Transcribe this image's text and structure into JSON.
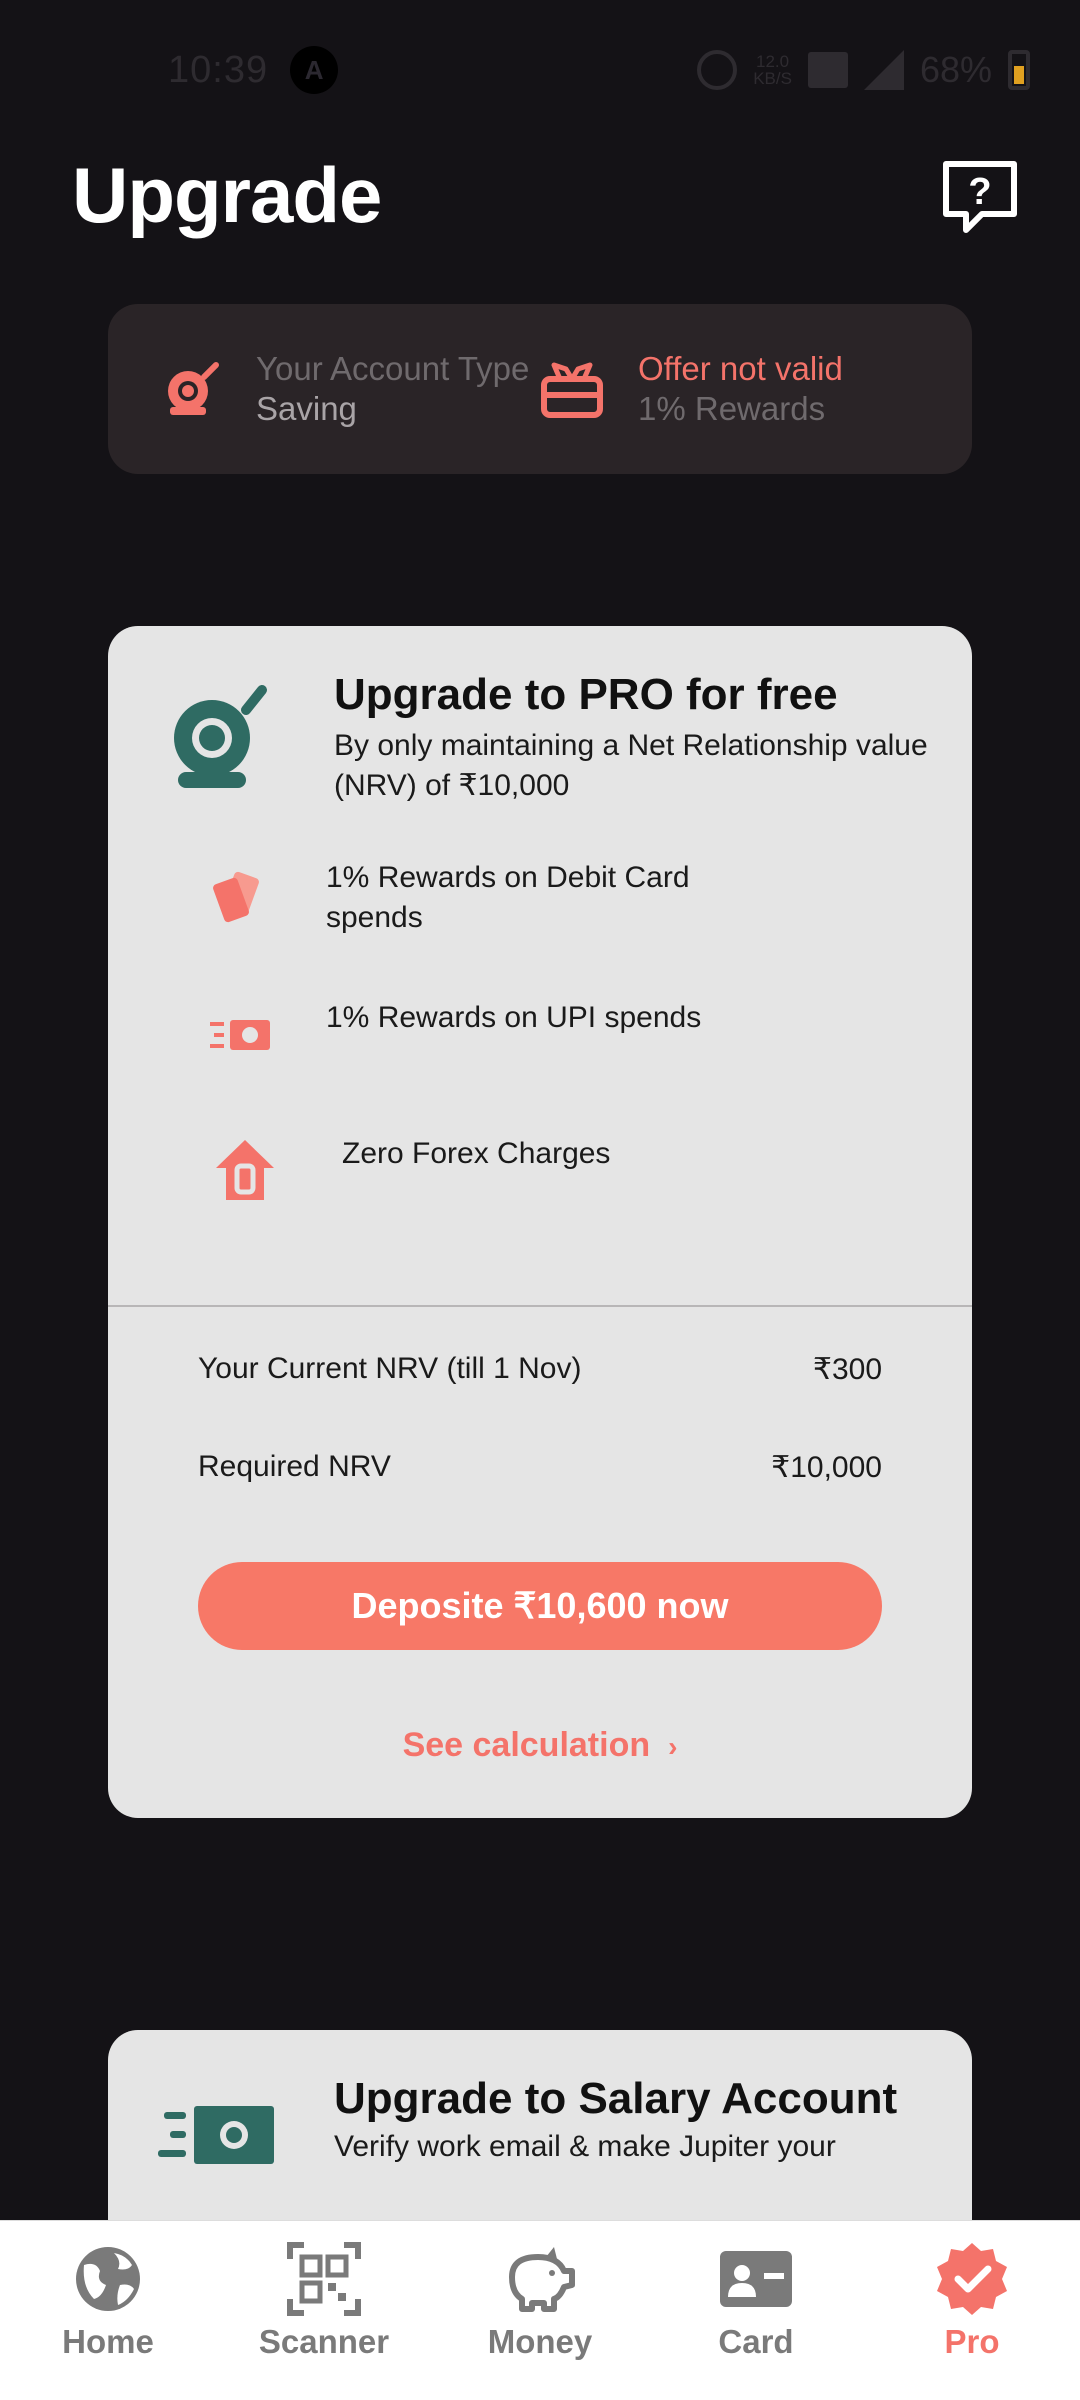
{
  "status_bar": {
    "time": "10:39",
    "app_badge": "A",
    "speed_value": "12.0",
    "speed_unit": "KB/S",
    "battery": "68%"
  },
  "header": {
    "title": "Upgrade",
    "help_icon": "question-chat-icon"
  },
  "account_strip": {
    "account_label": "Your Account Type",
    "account_value": "Saving",
    "offer_label": "Offer not valid",
    "offer_value": "1% Rewards"
  },
  "pro_card": {
    "title": "Upgrade to PRO for free",
    "subtitle": "By only maintaining a Net Relationship value (NRV) of ₹10,000",
    "benefits": [
      {
        "icon": "cards-icon",
        "text": "1% Rewards on Debit Card spends"
      },
      {
        "icon": "cash-fast-icon",
        "text": "1% Rewards on UPI spends"
      },
      {
        "icon": "zero-house-icon",
        "text": "Zero Forex Charges"
      }
    ],
    "current_nrv_label": "Your Current NRV (till 1 Nov)",
    "current_nrv_value": "₹300",
    "required_nrv_label": "Required NRV",
    "required_nrv_value": "₹10,000",
    "deposit_button": "Deposite ₹10,600 now",
    "see_calculation": "See calculation",
    "see_calculation_chevron": "›"
  },
  "salary_card": {
    "title": "Upgrade to Salary Account",
    "subtitle": "Verify work email & make Jupiter your"
  },
  "bottom_nav": {
    "items": [
      {
        "label": "Home",
        "icon": "globe-icon"
      },
      {
        "label": "Scanner",
        "icon": "qr-scanner-icon"
      },
      {
        "label": "Money",
        "icon": "piggy-bank-icon"
      },
      {
        "label": "Card",
        "icon": "id-card-icon"
      },
      {
        "label": "Pro",
        "icon": "verified-badge-icon"
      }
    ],
    "active": "Pro"
  },
  "colors": {
    "accent": "#f4736a",
    "teal_icon": "#2f6b63",
    "background": "#141216",
    "card": "#e5e5e5"
  }
}
